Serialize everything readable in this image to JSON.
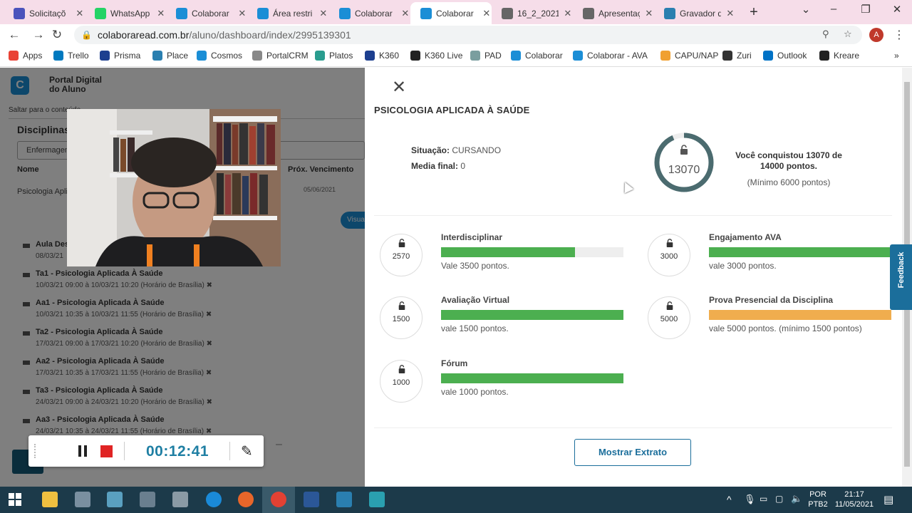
{
  "browser": {
    "tabs": [
      {
        "title": "Solicitaçõ",
        "icon": "teams-icon",
        "color": "#4b53bc"
      },
      {
        "title": "WhatsApp",
        "icon": "whatsapp-icon",
        "color": "#25d366"
      },
      {
        "title": "Colaborar",
        "icon": "colaborar-icon",
        "color": "#1b8ed6"
      },
      {
        "title": "Área restri",
        "icon": "colaborar-icon",
        "color": "#1b8ed6"
      },
      {
        "title": "Colaborar",
        "icon": "colaborar-icon",
        "color": "#1b8ed6"
      },
      {
        "title": "Colaborar",
        "icon": "colaborar-icon",
        "color": "#1b8ed6",
        "active": true
      },
      {
        "title": "16_2_2021",
        "icon": "globe-icon",
        "color": "#666666"
      },
      {
        "title": "Apresentaç",
        "icon": "globe-icon",
        "color": "#666666"
      },
      {
        "title": "Gravador d",
        "icon": "recorder-icon",
        "color": "#2a7fb0"
      }
    ],
    "url_host": "colaboraread.com.br",
    "url_path": "/aluno/dashboard/index/2995139301",
    "profile_initial": "A",
    "bookmarks": [
      {
        "label": "Apps",
        "color": "#e94235"
      },
      {
        "label": "Trello",
        "color": "#0079bf"
      },
      {
        "label": "Prisma",
        "color": "#1d3f8f"
      },
      {
        "label": "Place",
        "color": "#2a7fb0"
      },
      {
        "label": "Cosmos",
        "color": "#1b8ed6"
      },
      {
        "label": "PortalCRM",
        "color": "#888888"
      },
      {
        "label": "Platos",
        "color": "#2a9d8f"
      },
      {
        "label": "K360",
        "color": "#1d3f8f"
      },
      {
        "label": "K360 Live",
        "color": "#222222"
      },
      {
        "label": "PAD",
        "color": "#7a9e9f"
      },
      {
        "label": "Colaborar",
        "color": "#1b8ed6"
      },
      {
        "label": "Colaborar - AVA",
        "color": "#1b8ed6"
      },
      {
        "label": "CAPU/NAP",
        "color": "#f0a030"
      },
      {
        "label": "Zuri",
        "color": "#333333"
      },
      {
        "label": "Outlook",
        "color": "#0072c6"
      },
      {
        "label": "Kreare",
        "color": "#222222"
      }
    ]
  },
  "background_page": {
    "portal_line1": "Portal Digital",
    "portal_line2": "do Aluno",
    "skip_link": "Saltar para o conteúdo",
    "disciplinas_title": "Disciplinas",
    "course_select": "Enfermagem",
    "col_name": "Nome",
    "col_next": "Próx. Vencimento",
    "row_name": "Psicologia Aplicada",
    "row_date": "05/06/2021",
    "visualize_btn": "Visua",
    "activities": [
      {
        "title": "Aula Des",
        "dates": "08/03/21"
      },
      {
        "title": "Ta1 - Psicologia Aplicada À Saúde",
        "dates": "10/03/21 09:00 à 10/03/21 10:20 (Horário de Brasília) ✖"
      },
      {
        "title": "Aa1 - Psicologia Aplicada À Saúde",
        "dates": "10/03/21 10:35 à 10/03/21 11:55 (Horário de Brasília) ✖"
      },
      {
        "title": "Ta2 - Psicologia Aplicada À Saúde",
        "dates": "17/03/21 09:00 à 17/03/21 10:20 (Horário de Brasília) ✖"
      },
      {
        "title": "Aa2 - Psicologia Aplicada À Saúde",
        "dates": "17/03/21 10:35 à 17/03/21 11:55 (Horário de Brasília) ✖"
      },
      {
        "title": "Ta3 - Psicologia Aplicada À Saúde",
        "dates": "24/03/21 09:00 à 24/03/21 10:20 (Horário de Brasília) ✖"
      },
      {
        "title": "Aa3 - Psicologia Aplicada À Saúde",
        "dates": "24/03/21 10:35 à 24/03/21 11:55 (Horário de Brasília) ✖"
      }
    ]
  },
  "recorder": {
    "timer": "00:12:41"
  },
  "modal": {
    "close_label": "✕",
    "title": "PSICOLOGIA APLICADA À SAÚDE",
    "situacao_label": "Situação:",
    "situacao_value": "CURSANDO",
    "media_label": "Media final:",
    "media_value": "0",
    "points_total": "13070",
    "points_progress": 0.9336,
    "conquered_text": "Você conquistou 13070 de 14000 pontos.",
    "minimum_text": "(Mínimo 6000 pontos)",
    "categories": [
      {
        "name": "Interdisciplinar",
        "points": "2570",
        "vale": "Vale 3500 pontos.",
        "progress": 0.734,
        "color": "#4caf50"
      },
      {
        "name": "Engajamento AVA",
        "points": "3000",
        "vale": "vale 3000 pontos.",
        "progress": 1.0,
        "color": "#4caf50"
      },
      {
        "name": "Avaliação Virtual",
        "points": "1500",
        "vale": "vale 1500 pontos.",
        "progress": 1.0,
        "color": "#4caf50"
      },
      {
        "name": "Prova Presencial da Disciplina",
        "points": "5000",
        "vale": "vale 5000 pontos. (mínimo 1500 pontos)",
        "progress": 1.0,
        "color": "#f0ad4e"
      },
      {
        "name": "Fórum",
        "points": "1000",
        "vale": "vale 1000 pontos.",
        "progress": 1.0,
        "color": "#4caf50"
      }
    ],
    "extrato_button": "Mostrar Extrato",
    "feedback_tab": "Feedback"
  },
  "taskbar": {
    "lang_line1": "POR",
    "lang_line2": "PTB2",
    "time": "21:17",
    "date": "11/05/2021"
  }
}
